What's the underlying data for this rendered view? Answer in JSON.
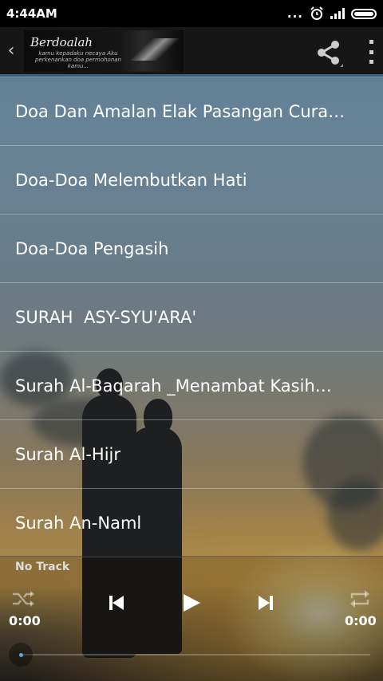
{
  "status_bar": {
    "time": "4:44AM",
    "dots": "..."
  },
  "action_bar": {
    "logo_title": "Berdoalah",
    "logo_subtitle": "kamu kepadaku necaya Aku perkenankan doa permohonan kamu..."
  },
  "list": {
    "items": [
      {
        "label": "Doa Dan Amalan Elak Pasangan Cura…"
      },
      {
        "label": "Doa-Doa Melembutkan Hati"
      },
      {
        "label": "Doa-Doa Pengasih"
      },
      {
        "label": "SURAH  ASY-SYU'ARA'"
      },
      {
        "label": "Surah Al-Baqarah _Menambat Kasih…"
      },
      {
        "label": "Surah Al-Hijr"
      },
      {
        "label": "Surah An-Naml"
      }
    ]
  },
  "player": {
    "track": "No Track",
    "elapsed": "0:00",
    "duration": "0:00",
    "progress": 0
  },
  "colors": {
    "accent": "#3a5d7c",
    "seek_thumb": "#5aa8d8"
  }
}
